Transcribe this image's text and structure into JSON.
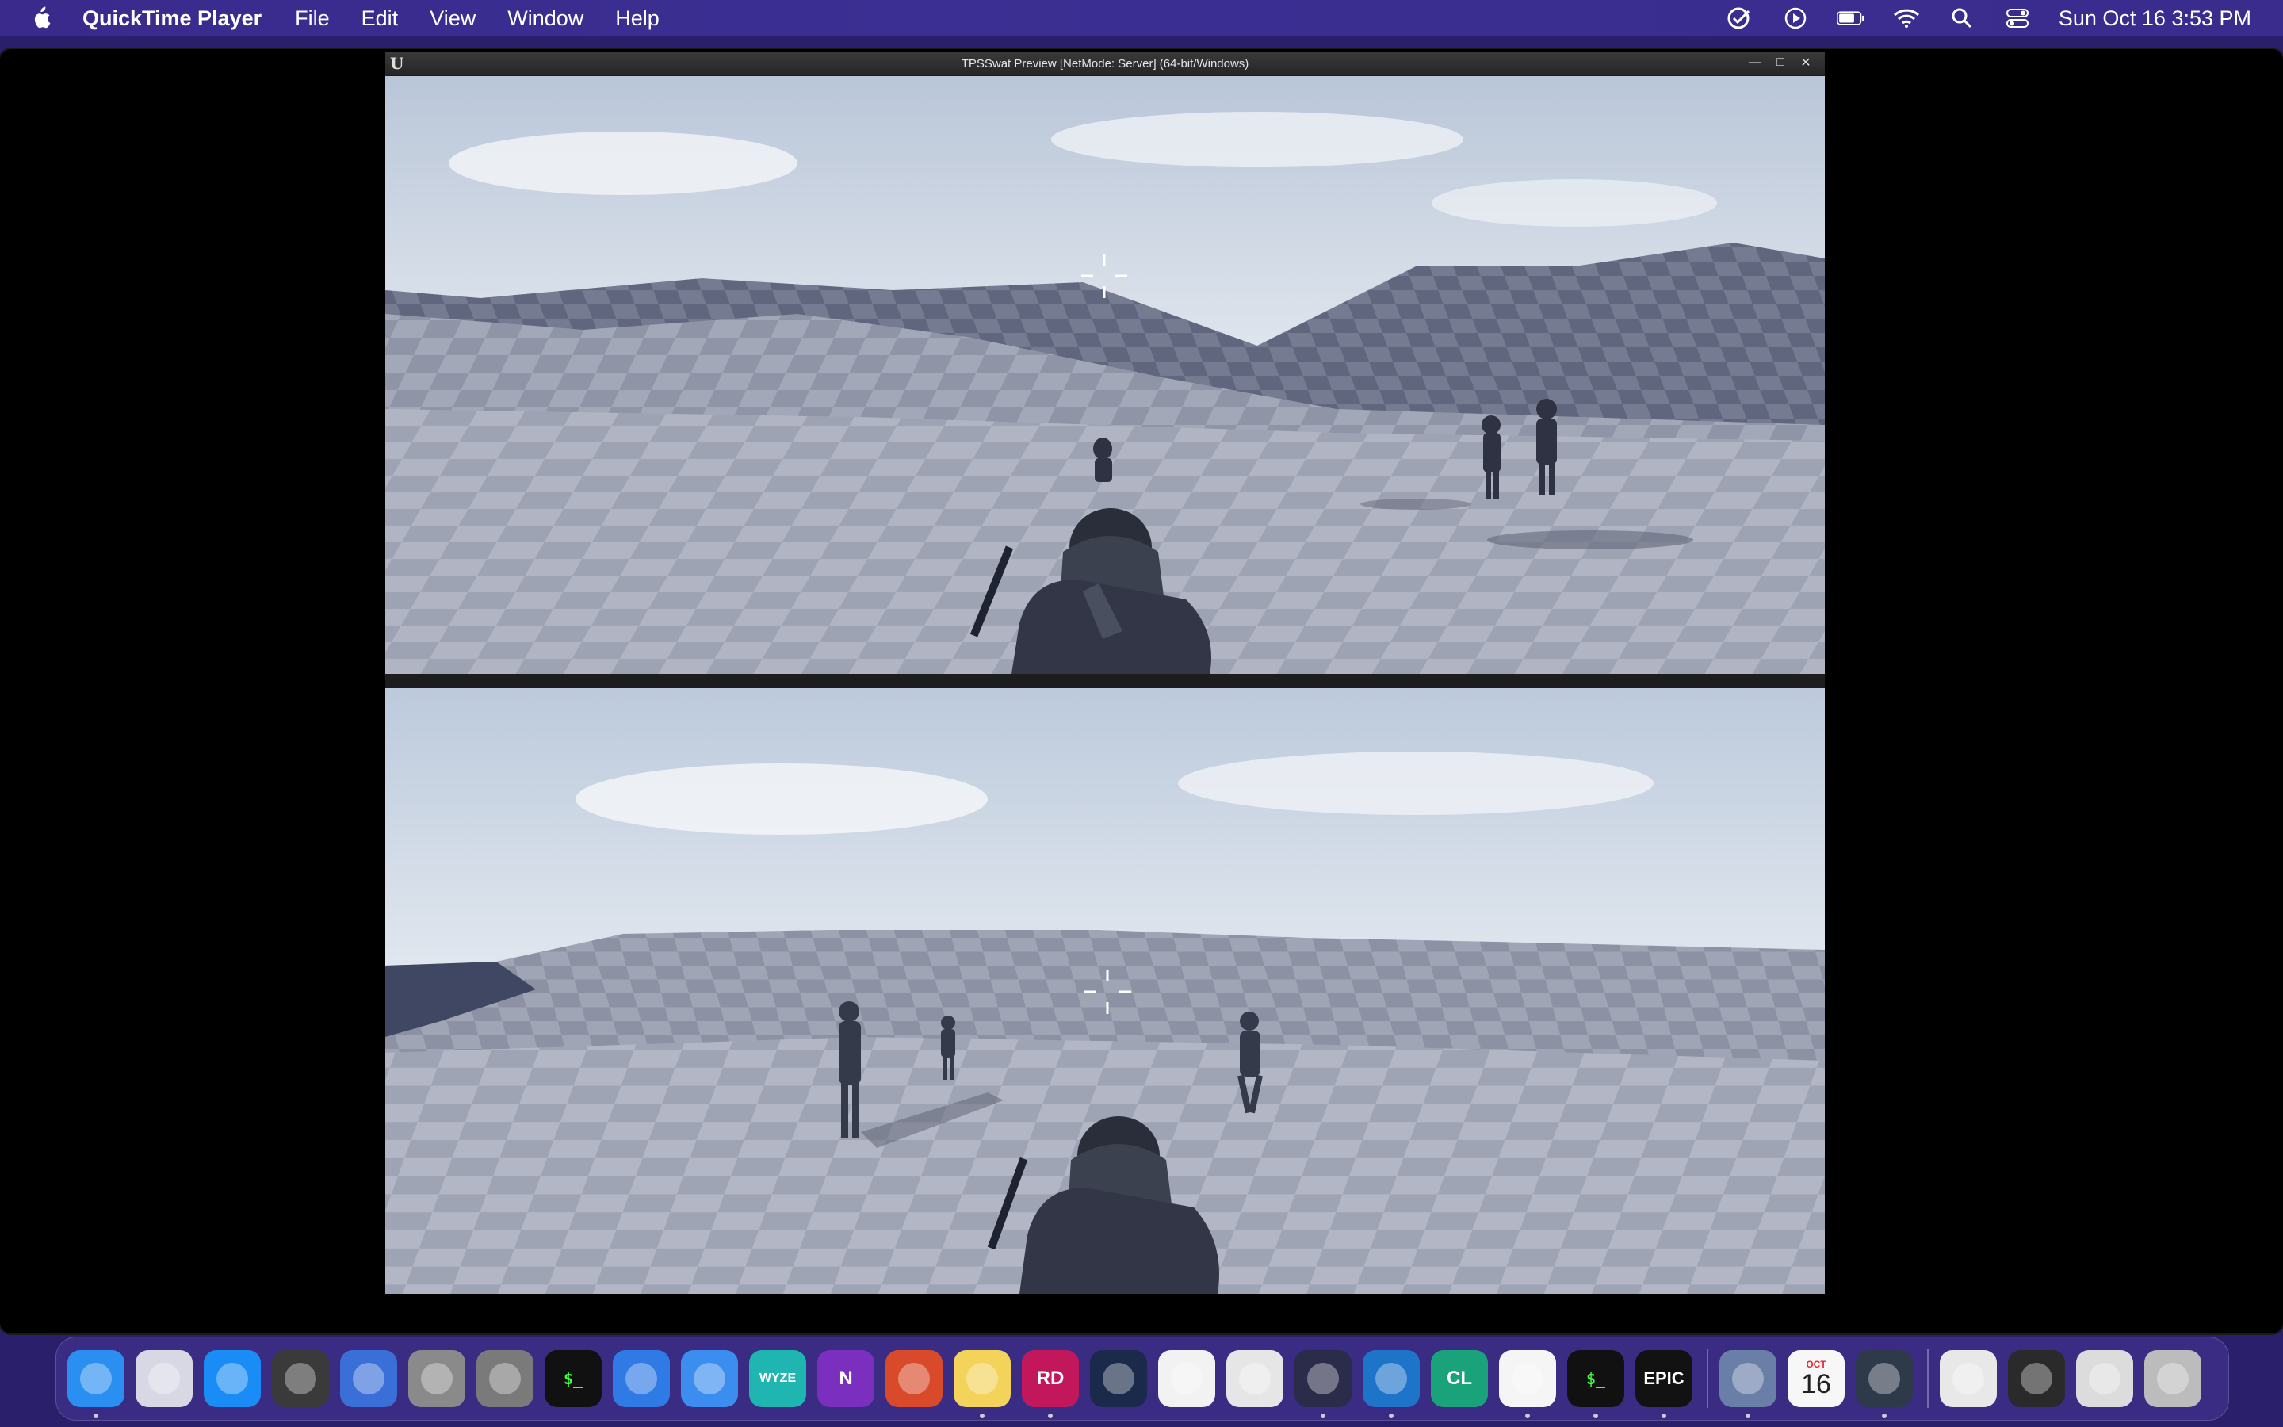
{
  "menubar": {
    "app_name": "QuickTime Player",
    "items": [
      "File",
      "Edit",
      "View",
      "Window",
      "Help"
    ],
    "clock": "Sun Oct 16  3:53 PM"
  },
  "game_window": {
    "title": "TPSSwat Preview [NetMode: Server]  (64-bit/Windows)"
  },
  "dock": {
    "items": [
      {
        "name": "finder-icon",
        "label": "",
        "color": "#2a8ff0",
        "running": true
      },
      {
        "name": "launchpad-icon",
        "label": "",
        "color": "#d8d8e4",
        "running": false
      },
      {
        "name": "app-store-icon",
        "label": "",
        "color": "#1a8cf5",
        "running": false
      },
      {
        "name": "dvd-player-icon",
        "label": "",
        "color": "#3a3a3a",
        "running": false
      },
      {
        "name": "swift-playgrounds-icon",
        "label": "",
        "color": "#3b6fd8",
        "running": false
      },
      {
        "name": "preview-icon",
        "label": "",
        "color": "#8a8a8a",
        "running": false
      },
      {
        "name": "system-preferences-icon",
        "label": "",
        "color": "#7a7a7a",
        "running": false
      },
      {
        "name": "terminal-icon",
        "label": "$_",
        "color": "#111111",
        "running": false
      },
      {
        "name": "xcode-instruments-icon",
        "label": "",
        "color": "#2f7ae5",
        "running": false
      },
      {
        "name": "xcode-icon",
        "label": "",
        "color": "#3b8df0",
        "running": false
      },
      {
        "name": "wyze-icon",
        "label": "WYZE",
        "color": "#1fb5b0",
        "running": false
      },
      {
        "name": "onenote-icon",
        "label": "N",
        "color": "#7a2fbf",
        "running": false
      },
      {
        "name": "remote-desktop-icon",
        "label": "",
        "color": "#d84a2a",
        "running": false
      },
      {
        "name": "notes-icon",
        "label": "",
        "color": "#f3d35a",
        "running": true
      },
      {
        "name": "rider-icon",
        "label": "RD",
        "color": "#c2185b",
        "running": true
      },
      {
        "name": "steam-icon",
        "label": "",
        "color": "#1b2a4a",
        "running": false
      },
      {
        "name": "instruments-icon",
        "label": "",
        "color": "#f2f2f2",
        "running": false
      },
      {
        "name": "unity-icon",
        "label": "",
        "color": "#e6e6e6",
        "running": false
      },
      {
        "name": "sublime-icon",
        "label": "",
        "color": "#2b2b4a",
        "running": true
      },
      {
        "name": "vscode-icon",
        "label": "",
        "color": "#1e74c8",
        "running": true
      },
      {
        "name": "clion-icon",
        "label": "CL",
        "color": "#1aa37a",
        "running": false
      },
      {
        "name": "chrome-icon",
        "label": "",
        "color": "#f5f5f5",
        "running": true
      },
      {
        "name": "terminal-2-icon",
        "label": "$_",
        "color": "#111111",
        "running": true
      },
      {
        "name": "epic-games-icon",
        "label": "EPIC",
        "color": "#121212",
        "running": true
      },
      {
        "name": "separator",
        "label": "",
        "color": "",
        "running": false
      },
      {
        "name": "preview-2-icon",
        "label": "",
        "color": "#6a7fa8",
        "running": true
      },
      {
        "name": "calendar-icon",
        "label": "16",
        "color": "#f7f7f7",
        "running": false
      },
      {
        "name": "quicktime-icon",
        "label": "",
        "color": "#2e3a4a",
        "running": true
      },
      {
        "name": "separator",
        "label": "",
        "color": "",
        "running": false
      },
      {
        "name": "html-file-icon",
        "label": "",
        "color": "#e8e8e8",
        "running": false
      },
      {
        "name": "window-thumb-icon",
        "label": "",
        "color": "#2a2a2a",
        "running": false
      },
      {
        "name": "window-thumb-2-icon",
        "label": "",
        "color": "#dcdcdc",
        "running": false
      },
      {
        "name": "trash-icon",
        "label": "",
        "color": "#bcbcbc",
        "running": false
      }
    ],
    "calendar_month": "OCT"
  }
}
